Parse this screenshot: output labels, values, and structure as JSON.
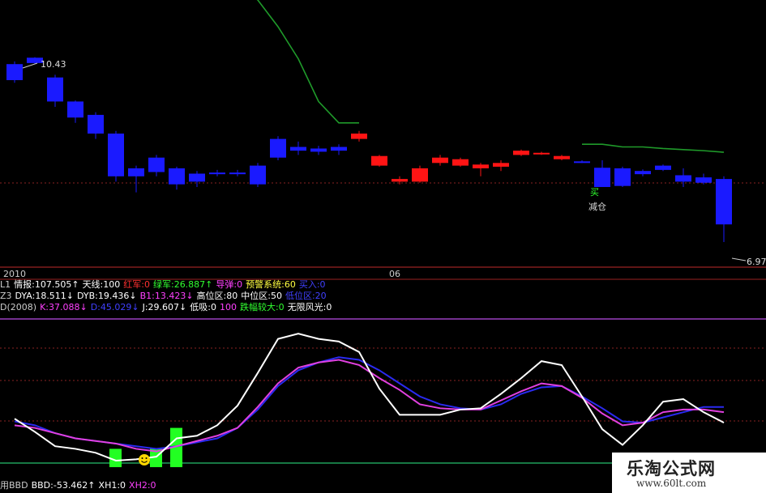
{
  "colors": {
    "up": "#ff1414",
    "down": "#1a1aff",
    "tianxian": "#1f9a2a",
    "dotline": "#8a2222",
    "k": "#ffffff",
    "d": "#e040e0",
    "j": "#2a2af0",
    "hist": "#22ff22",
    "baseline": "#1fa05a"
  },
  "price_panel": {
    "high_label": "10.43",
    "low_label": "6.97",
    "time_left": "2010",
    "time_mid": "06",
    "buy_sign": "买",
    "sell_sign": "减仓"
  },
  "indicator_rows": [
    {
      "items": [
        {
          "text": "L1",
          "color": "#cccccc"
        },
        {
          "text": "情报:107.505↑",
          "color": "#ffffff"
        },
        {
          "text": "天线:100",
          "color": "#ffffff"
        },
        {
          "text": "红军:0",
          "color": "#ff3030"
        },
        {
          "text": "绿军:26.887↑",
          "color": "#30ff30"
        },
        {
          "text": "导弹:0",
          "color": "#ff40ff"
        },
        {
          "text": "预警系统:60",
          "color": "#ffff40"
        },
        {
          "text": "买入:0",
          "color": "#4040ff"
        }
      ]
    },
    {
      "items": [
        {
          "text": "Z3",
          "color": "#cccccc"
        },
        {
          "text": "DYA:18.511↓",
          "color": "#ffffff"
        },
        {
          "text": "DYB:19.436↓",
          "color": "#ffffff"
        },
        {
          "text": "B1:13.423↓",
          "color": "#ff40ff"
        },
        {
          "text": "高位区:80",
          "color": "#ffffff"
        },
        {
          "text": "中位区:50",
          "color": "#ffffff"
        },
        {
          "text": "低位区:20",
          "color": "#4040ff"
        }
      ]
    },
    {
      "items": [
        {
          "text": "D(2008)",
          "color": "#cccccc"
        },
        {
          "text": "K:37.088↓",
          "color": "#ff40ff"
        },
        {
          "text": "D:45.029↓",
          "color": "#4040ff"
        },
        {
          "text": "J:29.607↓",
          "color": "#ffffff"
        },
        {
          "text": "低吸:0",
          "color": "#ffffff"
        },
        {
          "text": "100",
          "color": "#ff40ff"
        },
        {
          "text": "跌幅较大:0",
          "color": "#30ff30"
        },
        {
          "text": "无限风光:0",
          "color": "#ffffff"
        }
      ]
    }
  ],
  "bottom_row": [
    {
      "text": "用BBD",
      "color": "#cccccc"
    },
    {
      "text": "BBD:-53.462↑",
      "color": "#ffffff"
    },
    {
      "text": "XH1:0",
      "color": "#ffffff"
    },
    {
      "text": "XH2:0",
      "color": "#ff40ff"
    }
  ],
  "watermark": {
    "title": "乐淘公式网",
    "url": "www.60lt.com"
  },
  "chart_data": [
    {
      "type": "candlestick",
      "title": "",
      "ylim": [
        6.5,
        11.5
      ],
      "candles": [
        {
          "o": 10.3,
          "h": 10.35,
          "l": 9.95,
          "c": 10.0
        },
        {
          "o": 10.42,
          "h": 10.43,
          "l": 10.3,
          "c": 10.32
        },
        {
          "o": 10.05,
          "h": 10.1,
          "l": 9.5,
          "c": 9.6
        },
        {
          "o": 9.6,
          "h": 9.62,
          "l": 9.2,
          "c": 9.3
        },
        {
          "o": 9.35,
          "h": 9.4,
          "l": 8.9,
          "c": 9.0
        },
        {
          "o": 9.0,
          "h": 9.05,
          "l": 8.1,
          "c": 8.2
        },
        {
          "o": 8.35,
          "h": 8.4,
          "l": 7.9,
          "c": 8.2
        },
        {
          "o": 8.55,
          "h": 8.6,
          "l": 8.2,
          "c": 8.28
        },
        {
          "o": 8.35,
          "h": 8.38,
          "l": 7.95,
          "c": 8.05
        },
        {
          "o": 8.25,
          "h": 8.3,
          "l": 8.0,
          "c": 8.1
        },
        {
          "o": 8.27,
          "h": 8.32,
          "l": 8.2,
          "c": 8.24
        },
        {
          "o": 8.27,
          "h": 8.32,
          "l": 8.2,
          "c": 8.24
        },
        {
          "o": 8.4,
          "h": 8.45,
          "l": 8.0,
          "c": 8.05
        },
        {
          "o": 8.9,
          "h": 8.95,
          "l": 8.5,
          "c": 8.55
        },
        {
          "o": 8.75,
          "h": 8.85,
          "l": 8.6,
          "c": 8.68
        },
        {
          "o": 8.72,
          "h": 8.77,
          "l": 8.6,
          "c": 8.66
        },
        {
          "o": 8.75,
          "h": 8.8,
          "l": 8.6,
          "c": 8.68
        },
        {
          "o": 8.9,
          "h": 9.05,
          "l": 8.85,
          "c": 9.0
        },
        {
          "o": 8.4,
          "h": 8.6,
          "l": 8.38,
          "c": 8.58
        },
        {
          "o": 8.1,
          "h": 8.2,
          "l": 8.05,
          "c": 8.15
        },
        {
          "o": 8.1,
          "h": 8.4,
          "l": 8.08,
          "c": 8.35
        },
        {
          "o": 8.45,
          "h": 8.6,
          "l": 8.4,
          "c": 8.55
        },
        {
          "o": 8.4,
          "h": 8.55,
          "l": 8.38,
          "c": 8.52
        },
        {
          "o": 8.35,
          "h": 8.45,
          "l": 8.2,
          "c": 8.42
        },
        {
          "o": 8.38,
          "h": 8.5,
          "l": 8.3,
          "c": 8.45
        },
        {
          "o": 8.6,
          "h": 8.7,
          "l": 8.58,
          "c": 8.68
        },
        {
          "o": 8.62,
          "h": 8.66,
          "l": 8.6,
          "c": 8.64
        },
        {
          "o": 8.52,
          "h": 8.6,
          "l": 8.5,
          "c": 8.58
        },
        {
          "o": 8.48,
          "h": 8.5,
          "l": 8.45,
          "c": 8.47
        },
        {
          "o": 8.36,
          "h": 8.5,
          "l": 8.0,
          "c": 8.0
        },
        {
          "o": 8.35,
          "h": 8.38,
          "l": 8.0,
          "c": 8.02
        },
        {
          "o": 8.3,
          "h": 8.33,
          "l": 8.2,
          "c": 8.24
        },
        {
          "o": 8.4,
          "h": 8.42,
          "l": 8.3,
          "c": 8.32
        },
        {
          "o": 8.22,
          "h": 8.35,
          "l": 8.0,
          "c": 8.1
        },
        {
          "o": 8.18,
          "h": 8.25,
          "l": 8.05,
          "c": 8.08
        },
        {
          "o": 8.15,
          "h": 8.2,
          "l": 6.97,
          "c": 7.3
        }
      ],
      "tianxian": [
        13.9,
        13.9,
        13.9,
        13.9,
        12.9,
        12.2,
        12.2,
        11.8,
        11.8,
        11.8,
        11.8,
        11.8,
        11.5,
        11.0,
        10.4,
        9.6,
        9.2,
        9.2,
        null,
        null,
        null,
        null,
        null,
        null,
        null,
        null,
        null,
        null,
        8.8,
        8.8,
        8.75,
        8.75,
        8.72,
        8.7,
        8.68,
        8.65
      ]
    },
    {
      "type": "line",
      "title": "",
      "ylim": [
        -10,
        110
      ],
      "x": [
        0,
        1,
        2,
        3,
        4,
        5,
        6,
        7,
        8,
        9,
        10,
        11,
        12,
        13,
        14,
        15,
        16,
        17,
        18,
        19,
        20,
        21,
        22,
        23,
        24,
        25,
        26,
        27,
        28,
        29,
        30,
        31,
        32,
        33,
        34,
        35
      ],
      "series": [
        {
          "name": "K",
          "values": [
            35,
            25,
            14,
            12,
            9,
            3,
            4,
            6,
            20,
            22,
            30,
            45,
            70,
            96,
            100,
            96,
            94,
            86,
            58,
            38,
            38,
            38,
            42,
            43,
            54,
            66,
            79,
            76,
            52,
            27,
            15,
            30,
            48,
            50,
            40,
            32
          ]
        },
        {
          "name": "D",
          "values": [
            30,
            28,
            24,
            20,
            18,
            16,
            12,
            10,
            14,
            18,
            22,
            28,
            44,
            62,
            74,
            78,
            80,
            76,
            66,
            57,
            46,
            43,
            42,
            42,
            49,
            56,
            62,
            60,
            51,
            39,
            30,
            32,
            40,
            42,
            42,
            40
          ]
        },
        {
          "name": "J",
          "values": [
            33,
            30,
            24,
            20,
            18,
            16,
            14,
            12,
            14,
            17,
            20,
            28,
            42,
            60,
            72,
            78,
            82,
            80,
            72,
            62,
            52,
            46,
            43,
            42,
            46,
            54,
            59,
            60,
            52,
            43,
            33,
            32,
            36,
            40,
            44,
            44
          ]
        }
      ],
      "histogram": [
        null,
        null,
        null,
        null,
        null,
        12,
        null,
        12,
        28,
        null,
        null,
        null,
        null,
        null,
        null,
        null,
        null,
        null,
        null,
        null,
        null,
        null,
        null,
        null,
        null,
        null,
        null,
        null,
        null,
        null,
        null,
        null,
        null,
        null,
        null,
        null
      ]
    }
  ]
}
